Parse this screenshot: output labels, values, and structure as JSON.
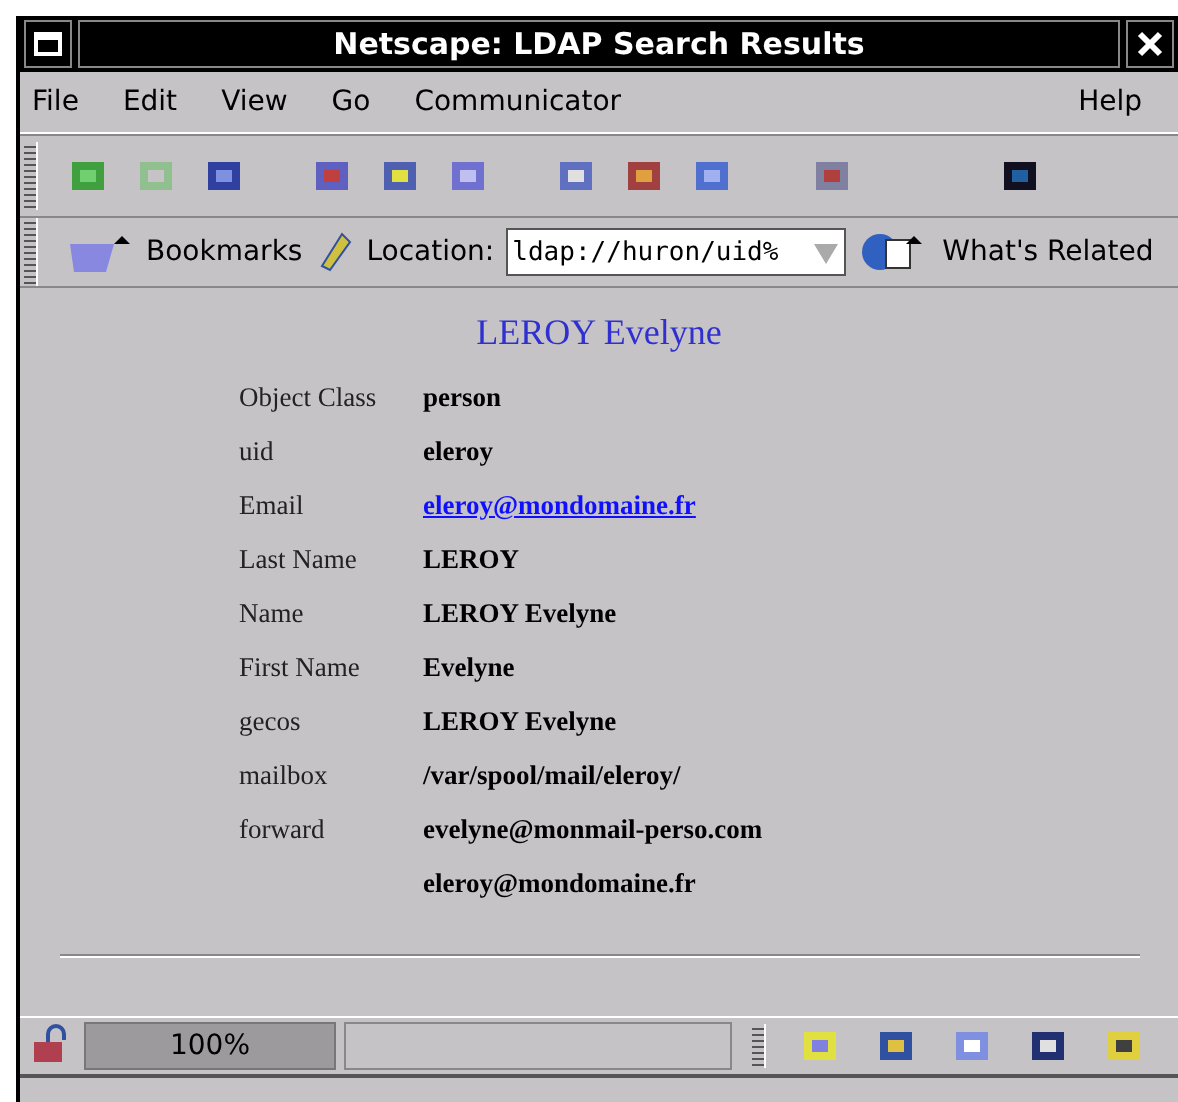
{
  "window": {
    "title": "Netscape: LDAP Search Results"
  },
  "menu": [
    "File",
    "Edit",
    "View",
    "Go",
    "Communicator"
  ],
  "help_menu": "Help",
  "location_bar": {
    "bookmarks": "Bookmarks",
    "label": "Location:",
    "value": "ldap://huron/uid%",
    "related": "What's Related"
  },
  "page": {
    "heading": "LEROY Evelyne",
    "rows": [
      {
        "label": "Object Class",
        "value": "person",
        "kind": "text"
      },
      {
        "label": "uid",
        "value": "eleroy",
        "kind": "text"
      },
      {
        "label": "Email",
        "value": "eleroy@mondomaine.fr",
        "kind": "link"
      },
      {
        "label": "Last Name",
        "value": "LEROY",
        "kind": "text"
      },
      {
        "label": "Name",
        "value": "LEROY Evelyne",
        "kind": "text"
      },
      {
        "label": "First Name",
        "value": "Evelyne",
        "kind": "text"
      },
      {
        "label": "gecos",
        "value": "LEROY Evelyne",
        "kind": "text"
      },
      {
        "label": "mailbox",
        "value": "/var/spool/mail/eleroy/",
        "kind": "text"
      },
      {
        "label": "forward",
        "value": "evelyne@monmail-perso.com",
        "kind": "text"
      },
      {
        "label": "",
        "value": "eleroy@mondomaine.fr",
        "kind": "text"
      }
    ]
  },
  "status_bar": {
    "zoom": "100%"
  }
}
